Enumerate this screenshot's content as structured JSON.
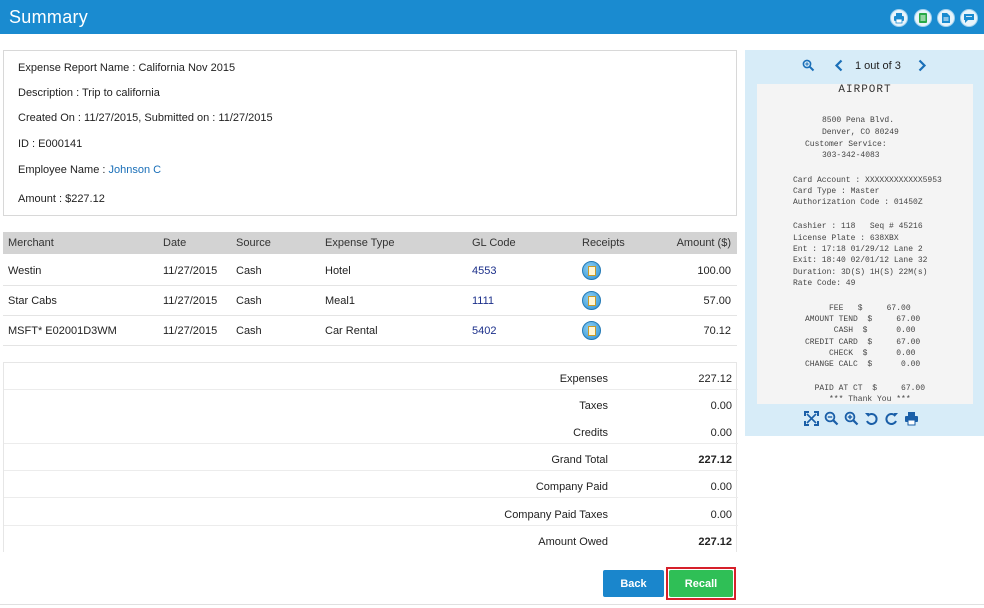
{
  "header": {
    "title": "Summary",
    "icons": [
      "printer-icon",
      "report-icon",
      "document-icon",
      "comment-icon"
    ]
  },
  "info": {
    "report_name_label": "Expense Report Name : ",
    "report_name": "California Nov 2015",
    "description_label": "Description : ",
    "description": "Trip to california",
    "created_label": "Created On : ",
    "created": "11/27/2015",
    "submitted_label": ", Submitted on : ",
    "submitted": "11/27/2015",
    "id_label": "ID : ",
    "id": "E000141",
    "employee_label": "Employee Name : ",
    "employee": "Johnson C",
    "amount_label": "Amount : ",
    "amount": "$227.12"
  },
  "expenses": {
    "headers": {
      "merchant": "Merchant",
      "date": "Date",
      "source": "Source",
      "type": "Expense Type",
      "gl": "GL Code",
      "receipts": "Receipts",
      "amount": "Amount ($)"
    },
    "rows": [
      {
        "merchant": "Westin",
        "date": "11/27/2015",
        "source": "Cash",
        "type": "Hotel",
        "gl": "4553",
        "amount": "100.00"
      },
      {
        "merchant": "Star Cabs",
        "date": "11/27/2015",
        "source": "Cash",
        "type": "Meal1",
        "gl": "1111",
        "amount": "57.00"
      },
      {
        "merchant": "MSFT* E02001D3WM",
        "date": "11/27/2015",
        "source": "Cash",
        "type": "Car Rental",
        "gl": "5402",
        "amount": "70.12"
      }
    ]
  },
  "totals": [
    {
      "label": "Expenses",
      "value": "227.12",
      "bold": false
    },
    {
      "label": "Taxes",
      "value": "0.00",
      "bold": false
    },
    {
      "label": "Credits",
      "value": "0.00",
      "bold": false
    },
    {
      "label": "Grand Total",
      "value": "227.12",
      "bold": true
    },
    {
      "label": "Company Paid",
      "value": "0.00",
      "bold": false
    },
    {
      "label": "Company Paid Taxes",
      "value": "0.00",
      "bold": false
    },
    {
      "label": "Amount Owed",
      "value": "227.12",
      "bold": true
    }
  ],
  "buttons": {
    "back": "Back",
    "recall": "Recall"
  },
  "viewer": {
    "pager": "1 out of 3",
    "receipt": {
      "title": "AIRPORT",
      "lines": [
        "8500 Pena Blvd.",
        "Denver, CO 80249",
        "Customer Service:",
        "303-342-4083",
        "Card Account : XXXXXXXXXXXX5953",
        "Card Type : Master",
        "Authorization Code : 01450Z",
        "Cashier : 118   Seq # 45216",
        "License Plate : 638XBX",
        "Ent : 17:18 01/29/12 Lane 2",
        "Exit: 18:40 02/01/12 Lane 32",
        "Duration: 3D(S) 1H(S) 22M(s)",
        "Rate Code: 49",
        "     FEE   $     67.00",
        "AMOUNT TEND  $     67.00",
        "      CASH  $      0.00",
        "CREDIT CARD  $     67.00",
        "     CHECK  $      0.00",
        "CHANGE CALC  $      0.00",
        "  PAID AT CT  $     67.00",
        "*** Thank You ***"
      ]
    },
    "tools": [
      "fullscreen-icon",
      "zoom-out-icon",
      "zoom-in-icon",
      "rotate-left-icon",
      "rotate-right-icon",
      "print-icon"
    ]
  }
}
